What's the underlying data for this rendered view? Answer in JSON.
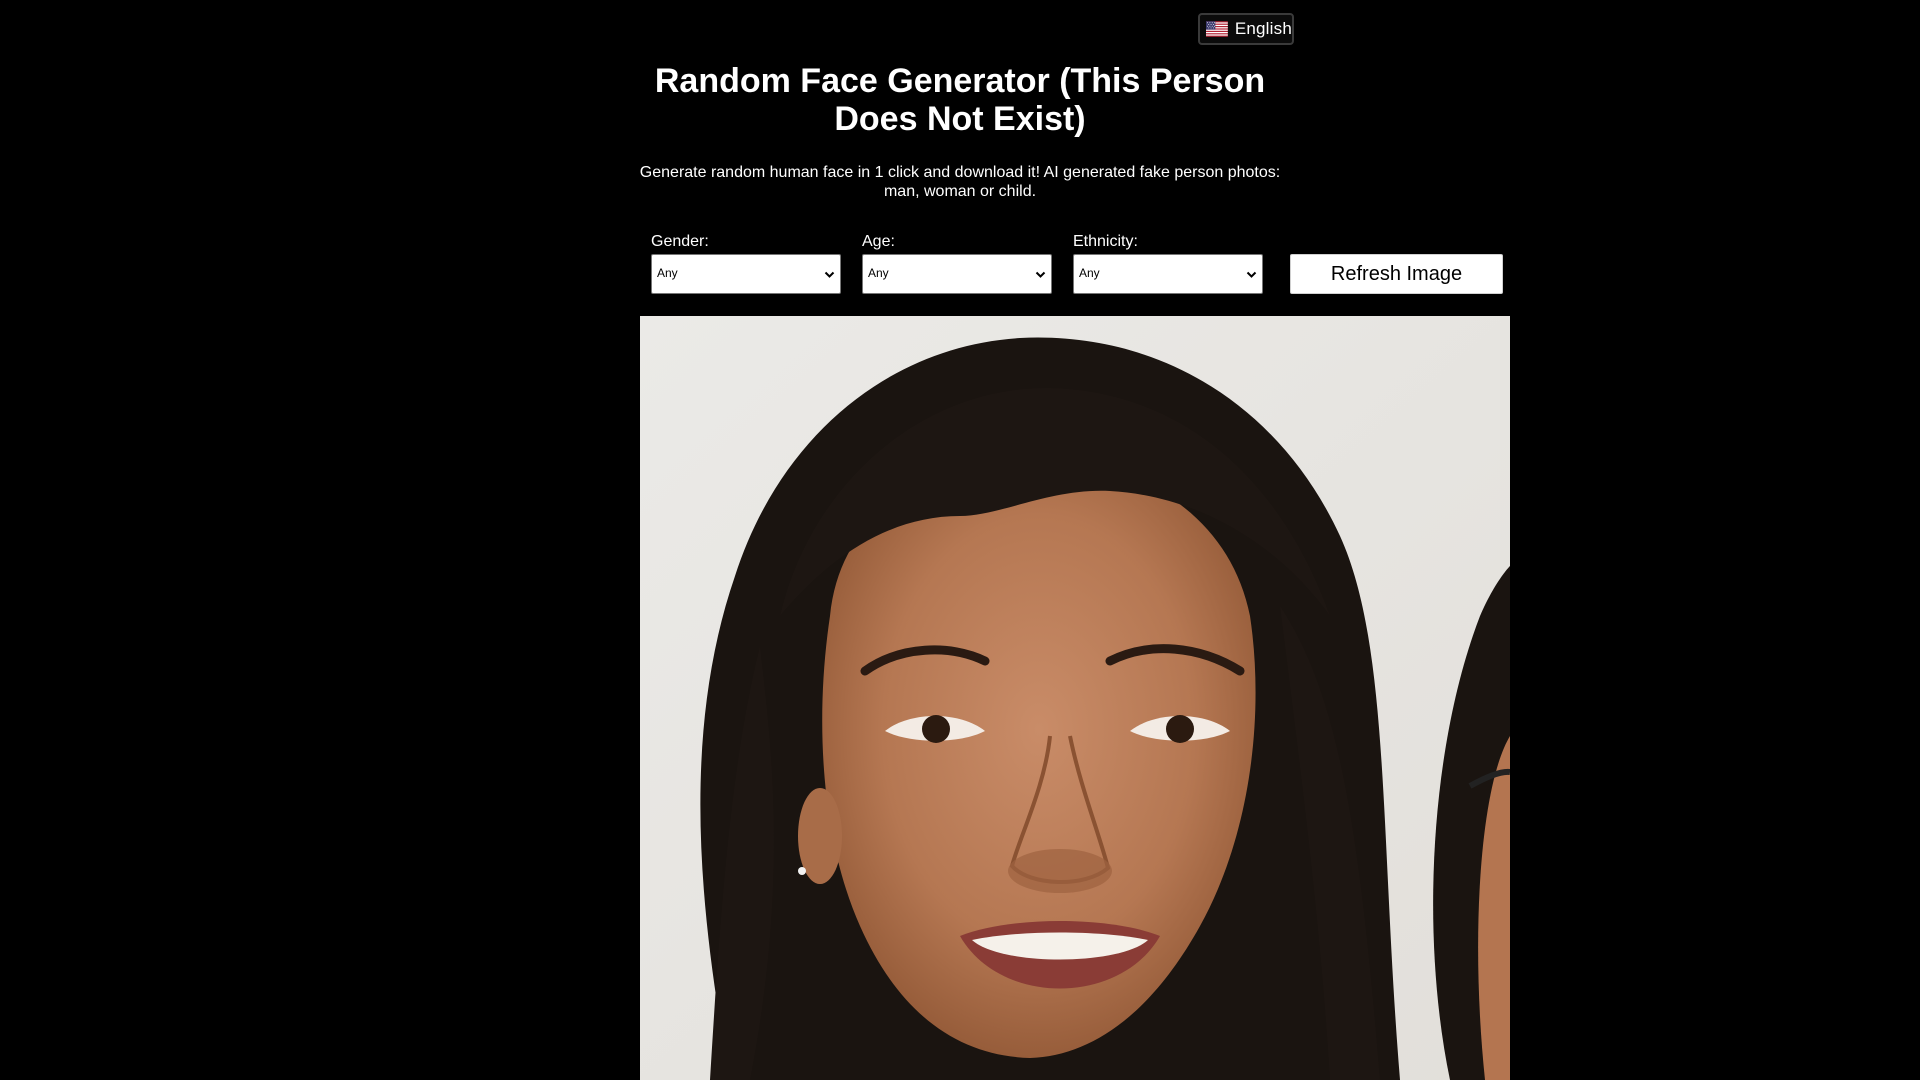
{
  "language": {
    "label": "English",
    "flag_icon": "us-flag-icon"
  },
  "header": {
    "title": "Random Face Generator (This Person Does Not Exist)",
    "subtitle": "Generate random human face in 1 click and download it! AI generated fake person photos: man, woman or child."
  },
  "filters": {
    "gender": {
      "label": "Gender:",
      "value": "Any"
    },
    "age": {
      "label": "Age:",
      "value": "Any"
    },
    "ethnicity": {
      "label": "Ethnicity:",
      "value": "Any"
    }
  },
  "refresh_label": "Refresh Image",
  "colors": {
    "background": "#000000",
    "text": "#ffffff",
    "control_bg": "#ffffff"
  }
}
